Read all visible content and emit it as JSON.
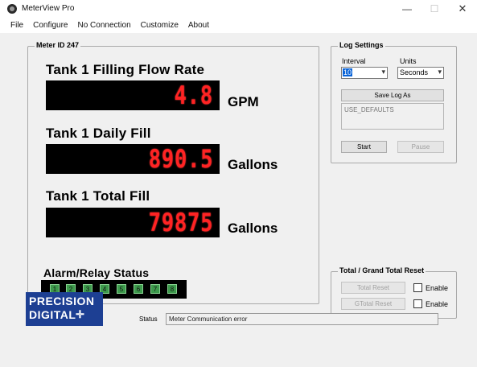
{
  "window": {
    "title": "MeterView Pro",
    "minimize": "—",
    "maximize": "☐",
    "close": "✕"
  },
  "menu": [
    "File",
    "Configure",
    "No Connection",
    "Customize",
    "About"
  ],
  "meter": {
    "group_title": "Meter ID 247",
    "readings": [
      {
        "label": "Tank 1 Filling Flow Rate",
        "value": "4.8",
        "unit": "GPM"
      },
      {
        "label": "Tank 1 Daily Fill",
        "value": "890.5",
        "unit": "Gallons"
      },
      {
        "label": "Tank 1 Total Fill",
        "value": "79875",
        "unit": "Gallons"
      }
    ],
    "alarm_title": "Alarm/Relay Status",
    "relays": [
      "1",
      "2",
      "3",
      "4",
      "5",
      "6",
      "7",
      "8"
    ],
    "colors": {
      "lcd_text": "#ff2323",
      "relay_on": "#3d9a4c"
    }
  },
  "log_settings": {
    "title": "Log Settings",
    "interval_label": "Interval",
    "interval_value": "10",
    "units_label": "Units",
    "units_value": "Seconds",
    "save_log_label": "Save Log As",
    "log_path": "USE_DEFAULTS",
    "start_label": "Start",
    "pause_label": "Pause"
  },
  "reset": {
    "title": "Total / Grand Total Reset",
    "total_reset_label": "Total Reset",
    "gtotal_reset_label": "GTotal Reset",
    "enable_label_1": "Enable",
    "enable_label_2": "Enable"
  },
  "logo": {
    "line1": "PRECISION",
    "line2": "DIGITAL",
    "mark": "✛"
  },
  "status": {
    "label": "Status",
    "text": "Meter Communication error"
  },
  "icons": {
    "app": "meter-app-icon",
    "chevron": "▾"
  }
}
